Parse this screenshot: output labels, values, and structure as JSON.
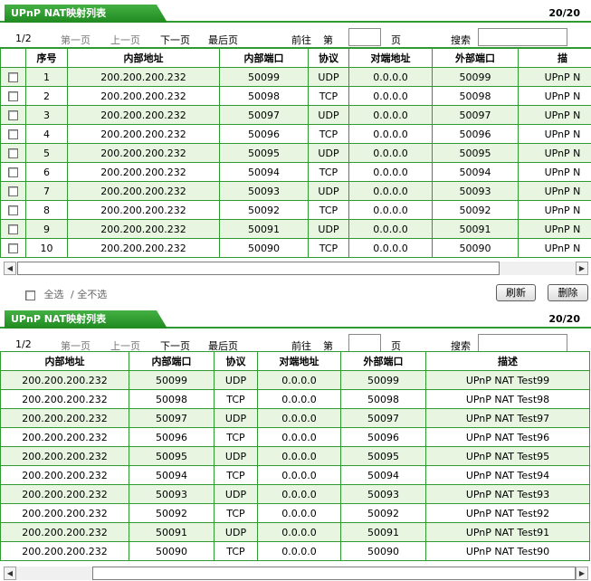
{
  "panel1": {
    "title": "UPnP NAT映射列表",
    "page_count": "20/20",
    "nav": {
      "page": "1/2",
      "first": "第一页",
      "prev": "上一页",
      "next": "下一页",
      "last": "最后页",
      "goto": "前往",
      "goto_prefix": "第",
      "goto_suffix": "页",
      "search": "搜索"
    },
    "columns": [
      "序号",
      "内部地址",
      "内部端口",
      "协议",
      "对端地址",
      "外部端口",
      "描"
    ],
    "rows": [
      {
        "no": "1",
        "ip": "200.200.200.232",
        "iport": "50099",
        "proto": "UDP",
        "peer": "0.0.0.0",
        "eport": "50099",
        "desc": "UPnP N"
      },
      {
        "no": "2",
        "ip": "200.200.200.232",
        "iport": "50098",
        "proto": "TCP",
        "peer": "0.0.0.0",
        "eport": "50098",
        "desc": "UPnP N"
      },
      {
        "no": "3",
        "ip": "200.200.200.232",
        "iport": "50097",
        "proto": "UDP",
        "peer": "0.0.0.0",
        "eport": "50097",
        "desc": "UPnP N"
      },
      {
        "no": "4",
        "ip": "200.200.200.232",
        "iport": "50096",
        "proto": "TCP",
        "peer": "0.0.0.0",
        "eport": "50096",
        "desc": "UPnP N"
      },
      {
        "no": "5",
        "ip": "200.200.200.232",
        "iport": "50095",
        "proto": "UDP",
        "peer": "0.0.0.0",
        "eport": "50095",
        "desc": "UPnP N"
      },
      {
        "no": "6",
        "ip": "200.200.200.232",
        "iport": "50094",
        "proto": "TCP",
        "peer": "0.0.0.0",
        "eport": "50094",
        "desc": "UPnP N"
      },
      {
        "no": "7",
        "ip": "200.200.200.232",
        "iport": "50093",
        "proto": "UDP",
        "peer": "0.0.0.0",
        "eport": "50093",
        "desc": "UPnP N"
      },
      {
        "no": "8",
        "ip": "200.200.200.232",
        "iport": "50092",
        "proto": "TCP",
        "peer": "0.0.0.0",
        "eport": "50092",
        "desc": "UPnP N"
      },
      {
        "no": "9",
        "ip": "200.200.200.232",
        "iport": "50091",
        "proto": "UDP",
        "peer": "0.0.0.0",
        "eport": "50091",
        "desc": "UPnP N"
      },
      {
        "no": "10",
        "ip": "200.200.200.232",
        "iport": "50090",
        "proto": "TCP",
        "peer": "0.0.0.0",
        "eport": "50090",
        "desc": "UPnP N"
      }
    ],
    "select_all": "全选",
    "deselect_all": "/ 全不选",
    "refresh_label": "刷新",
    "delete_label": "删除"
  },
  "panel2": {
    "title": "UPnP NAT映射列表",
    "page_count": "20/20",
    "nav": {
      "page": "1/2",
      "first": "第一页",
      "prev": "上一页",
      "next": "下一页",
      "last": "最后页",
      "goto": "前往",
      "goto_prefix": "第",
      "goto_suffix": "页",
      "search": "搜索"
    },
    "columns": [
      "内部地址",
      "内部端口",
      "协议",
      "对端地址",
      "外部端口",
      "描述"
    ],
    "rows": [
      {
        "ip": "200.200.200.232",
        "iport": "50099",
        "proto": "UDP",
        "peer": "0.0.0.0",
        "eport": "50099",
        "desc": "UPnP NAT Test99"
      },
      {
        "ip": "200.200.200.232",
        "iport": "50098",
        "proto": "TCP",
        "peer": "0.0.0.0",
        "eport": "50098",
        "desc": "UPnP NAT Test98"
      },
      {
        "ip": "200.200.200.232",
        "iport": "50097",
        "proto": "UDP",
        "peer": "0.0.0.0",
        "eport": "50097",
        "desc": "UPnP NAT Test97"
      },
      {
        "ip": "200.200.200.232",
        "iport": "50096",
        "proto": "TCP",
        "peer": "0.0.0.0",
        "eport": "50096",
        "desc": "UPnP NAT Test96"
      },
      {
        "ip": "200.200.200.232",
        "iport": "50095",
        "proto": "UDP",
        "peer": "0.0.0.0",
        "eport": "50095",
        "desc": "UPnP NAT Test95"
      },
      {
        "ip": "200.200.200.232",
        "iport": "50094",
        "proto": "TCP",
        "peer": "0.0.0.0",
        "eport": "50094",
        "desc": "UPnP NAT Test94"
      },
      {
        "ip": "200.200.200.232",
        "iport": "50093",
        "proto": "UDP",
        "peer": "0.0.0.0",
        "eport": "50093",
        "desc": "UPnP NAT Test93"
      },
      {
        "ip": "200.200.200.232",
        "iport": "50092",
        "proto": "TCP",
        "peer": "0.0.0.0",
        "eport": "50092",
        "desc": "UPnP NAT Test92"
      },
      {
        "ip": "200.200.200.232",
        "iport": "50091",
        "proto": "UDP",
        "peer": "0.0.0.0",
        "eport": "50091",
        "desc": "UPnP NAT Test91"
      },
      {
        "ip": "200.200.200.232",
        "iport": "50090",
        "proto": "TCP",
        "peer": "0.0.0.0",
        "eport": "50090",
        "desc": "UPnP NAT Test90"
      }
    ]
  },
  "icons": {
    "scroll_left": "◀",
    "scroll_right": "▶"
  }
}
